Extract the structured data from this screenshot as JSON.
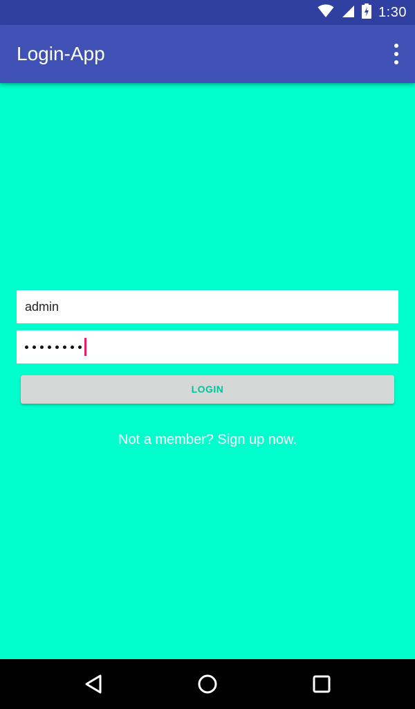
{
  "status_bar": {
    "time": "1:30",
    "icons": [
      "wifi-icon",
      "signal-icon",
      "battery-charging-icon"
    ]
  },
  "app_bar": {
    "title": "Login-App",
    "overflow_icon": "more-vert-icon"
  },
  "form": {
    "username_value": "admin",
    "password_masked": "••••••••",
    "login_label": "LOGIN",
    "signup_text": "Not a member? Sign up now."
  },
  "nav_bar": {
    "icons": [
      "back-icon",
      "home-icon",
      "recents-icon"
    ]
  },
  "colors": {
    "status_bar": "#3040a0",
    "app_bar": "#3f51b5",
    "background": "#00ffcc",
    "accent": "#e91e63",
    "button": "#d6d7d7",
    "button_text": "#00c49a"
  }
}
